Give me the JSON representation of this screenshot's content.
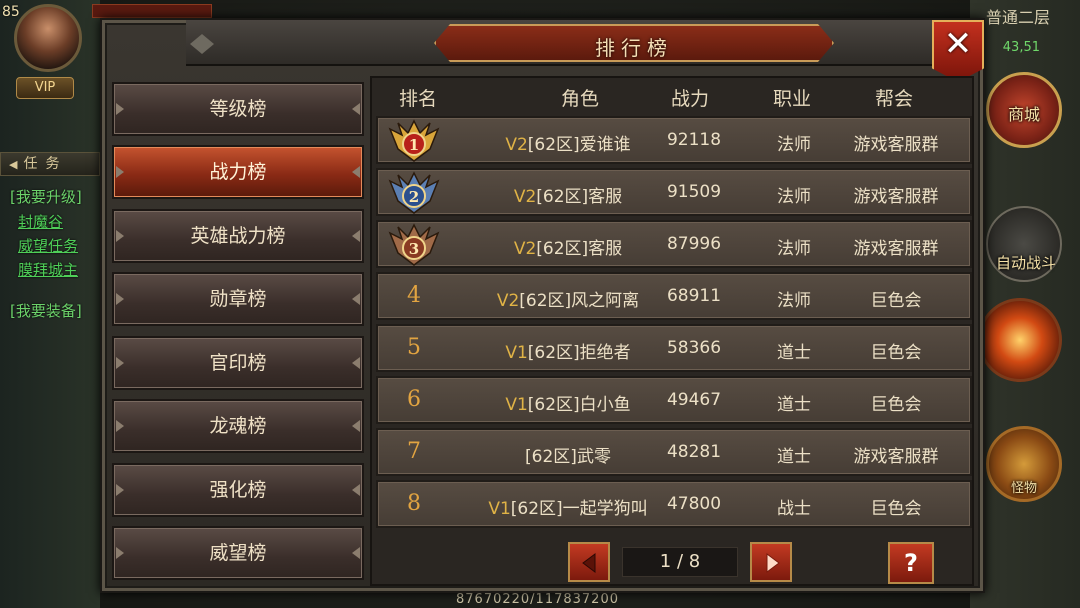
{
  "hud": {
    "level": "85",
    "vip_label": "VIP",
    "quest_tab_label": "任务",
    "quest_lines": [
      "[我要升级]",
      "封魔谷",
      "威望任务",
      "膜拜城主",
      "[我要装备]"
    ],
    "map_name": "普通二层",
    "coords": "43,51",
    "shop_label": "商城",
    "auto_battle_label": "自动战斗",
    "monster_label": "怪物",
    "exp_text": "87670220/117837200"
  },
  "panel": {
    "title": "排行榜",
    "close_label": "✕",
    "tabs": [
      {
        "label": "等级榜",
        "active": false
      },
      {
        "label": "战力榜",
        "active": true
      },
      {
        "label": "英雄战力榜",
        "active": false
      },
      {
        "label": "勋章榜",
        "active": false
      },
      {
        "label": "官印榜",
        "active": false
      },
      {
        "label": "龙魂榜",
        "active": false
      },
      {
        "label": "强化榜",
        "active": false
      },
      {
        "label": "威望榜",
        "active": false
      }
    ],
    "columns": [
      "排名",
      "角色",
      "战力",
      "职业",
      "帮会"
    ],
    "rows": [
      {
        "rank": "1",
        "vip": "V2",
        "name": "[62区]爱谁谁",
        "power": "92118",
        "job": "法师",
        "guild": "游戏客服群"
      },
      {
        "rank": "2",
        "vip": "V2",
        "name": "[62区]客服",
        "power": "91509",
        "job": "法师",
        "guild": "游戏客服群"
      },
      {
        "rank": "3",
        "vip": "V2",
        "name": "[62区]客服",
        "power": "87996",
        "job": "法师",
        "guild": "游戏客服群"
      },
      {
        "rank": "4",
        "vip": "V2",
        "name": "[62区]风之阿离",
        "power": "68911",
        "job": "法师",
        "guild": "巨色会"
      },
      {
        "rank": "5",
        "vip": "V1",
        "name": "[62区]拒绝者",
        "power": "58366",
        "job": "道士",
        "guild": "巨色会"
      },
      {
        "rank": "6",
        "vip": "V1",
        "name": "[62区]白小鱼",
        "power": "49467",
        "job": "道士",
        "guild": "巨色会"
      },
      {
        "rank": "7",
        "vip": "",
        "name": "[62区]武零",
        "power": "48281",
        "job": "道士",
        "guild": "游戏客服群"
      },
      {
        "rank": "8",
        "vip": "V1",
        "name": "[62区]一起学狗叫",
        "power": "47800",
        "job": "战士",
        "guild": "巨色会"
      }
    ],
    "page_indicator": "1 / 8",
    "help_label": "?"
  },
  "colors": {
    "medal_gold": "#d9a53a",
    "medal_silver": "#5b7fb3",
    "medal_bronze": "#a06a48",
    "active_tab": "#c5542f",
    "rank_text": "#e2a441",
    "vip_text": "#e0b346"
  }
}
